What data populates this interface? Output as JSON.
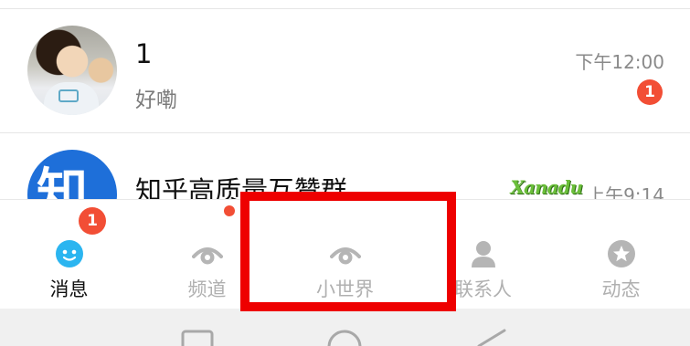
{
  "chats": [
    {
      "name": "1",
      "preview": "好嘞",
      "time": "下午12:00",
      "unread": "1",
      "avatar": "photo-avatar"
    },
    {
      "name": "知乎高质量互赞群",
      "preview": "",
      "time": "上午9:14",
      "avatar_text": "知",
      "logo_text": "Xanadu"
    }
  ],
  "tabs": [
    {
      "label": "消息",
      "icon": "message-icon",
      "badge": "1",
      "active": true
    },
    {
      "label": "频道",
      "icon": "eye-icon",
      "dot": true
    },
    {
      "label": "小世界",
      "icon": "eye-icon"
    },
    {
      "label": "联系人",
      "icon": "person-icon"
    },
    {
      "label": "动态",
      "icon": "star-icon"
    }
  ],
  "colors": {
    "badge": "#f24e35",
    "active_label": "#111111",
    "inactive_label": "#b0b0b0",
    "highlight": "#ee0000",
    "message_icon": "#2bb5f0"
  }
}
